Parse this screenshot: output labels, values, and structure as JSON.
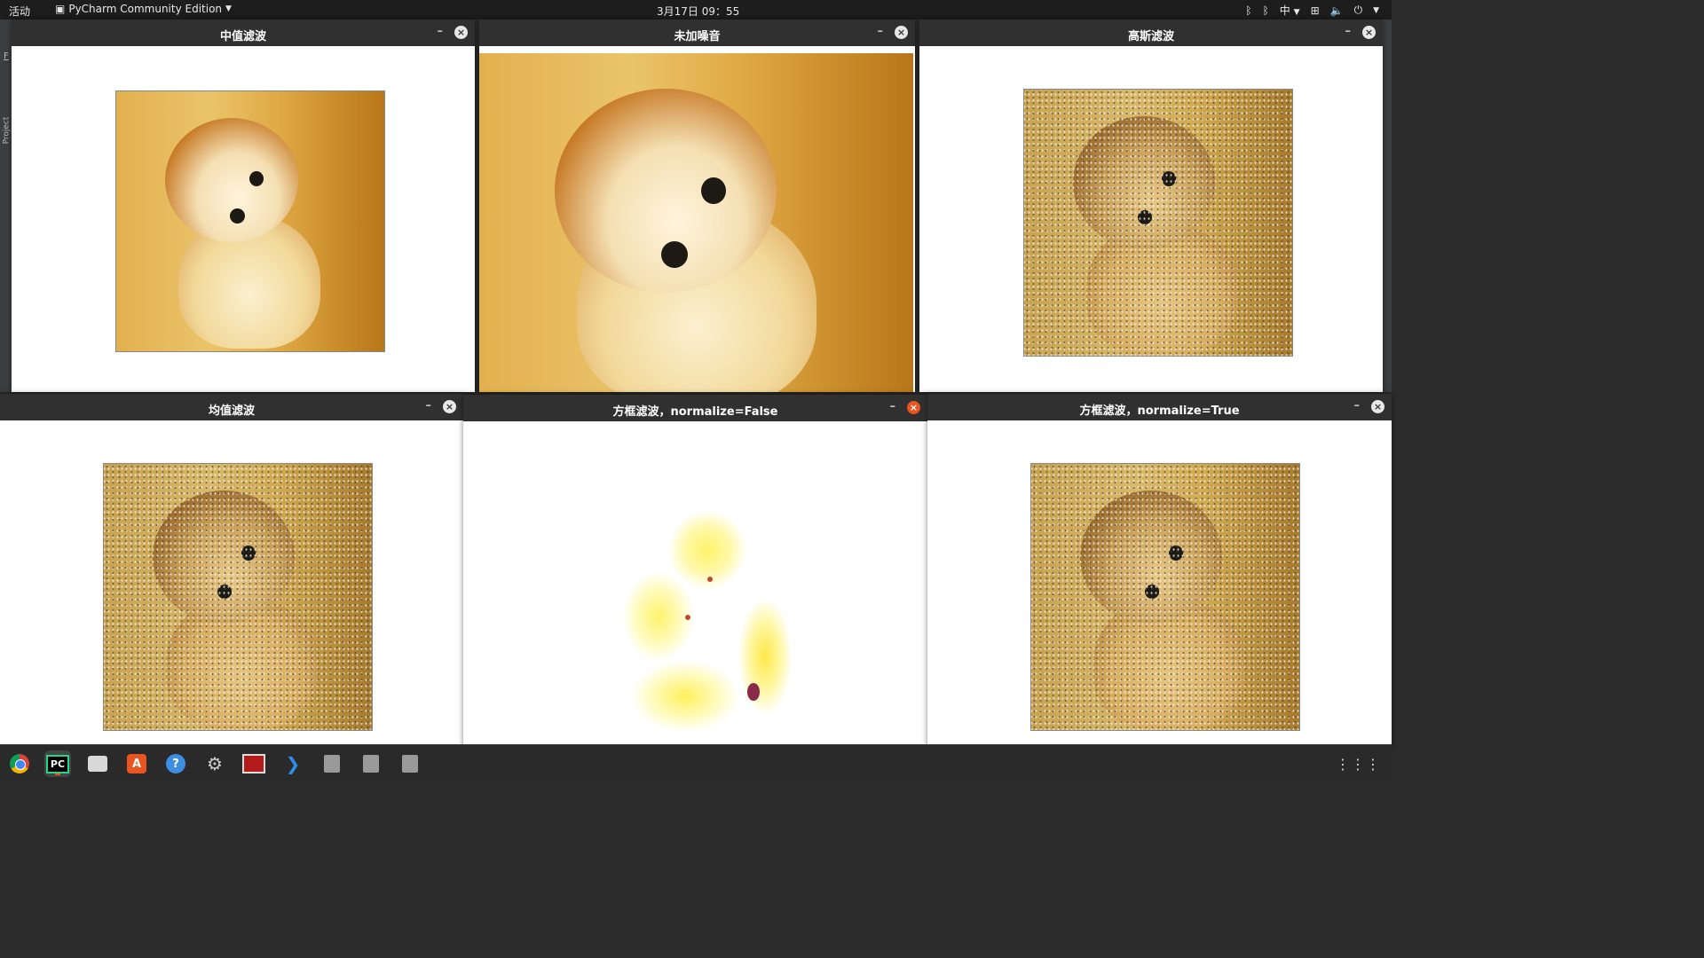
{
  "topbar": {
    "activities": "活动",
    "app_name": "PyCharm Community Edition",
    "clock": "3月17日  09：55",
    "input_method": "中"
  },
  "ide_background": {
    "menu_letter": "F",
    "project_tab": "Project"
  },
  "windows": [
    {
      "id": "median",
      "title": "中值滤波"
    },
    {
      "id": "original",
      "title": "未加噪音"
    },
    {
      "id": "gaussian",
      "title": "高斯滤波"
    },
    {
      "id": "mean",
      "title": "均值滤波"
    },
    {
      "id": "box_false",
      "title": "方框滤波，normalize=False"
    },
    {
      "id": "box_true",
      "title": "方框滤波，normalize=True"
    }
  ],
  "window_controls": {
    "minimize": "–",
    "close": "×"
  },
  "dock": {
    "items": [
      {
        "name": "chrome",
        "icon": "chrome-icon"
      },
      {
        "name": "pycharm",
        "label": "PC",
        "icon": "pycharm-icon"
      },
      {
        "name": "files",
        "icon": "folder-icon"
      },
      {
        "name": "software",
        "label": "A",
        "icon": "software-center-icon"
      },
      {
        "name": "help",
        "label": "?",
        "icon": "help-icon"
      },
      {
        "name": "settings",
        "icon": "gear-icon"
      },
      {
        "name": "image-viewer",
        "icon": "image-viewer-icon"
      },
      {
        "name": "vscode",
        "icon": "vscode-icon"
      },
      {
        "name": "usb1",
        "icon": "usb-icon"
      },
      {
        "name": "usb2",
        "icon": "usb-icon"
      },
      {
        "name": "usb3",
        "icon": "usb-icon"
      }
    ],
    "show_apps": "⋮⋮⋮"
  },
  "colors": {
    "accent": "#e95420",
    "titlebar": "#303030",
    "topbar": "#1d1d1d"
  }
}
